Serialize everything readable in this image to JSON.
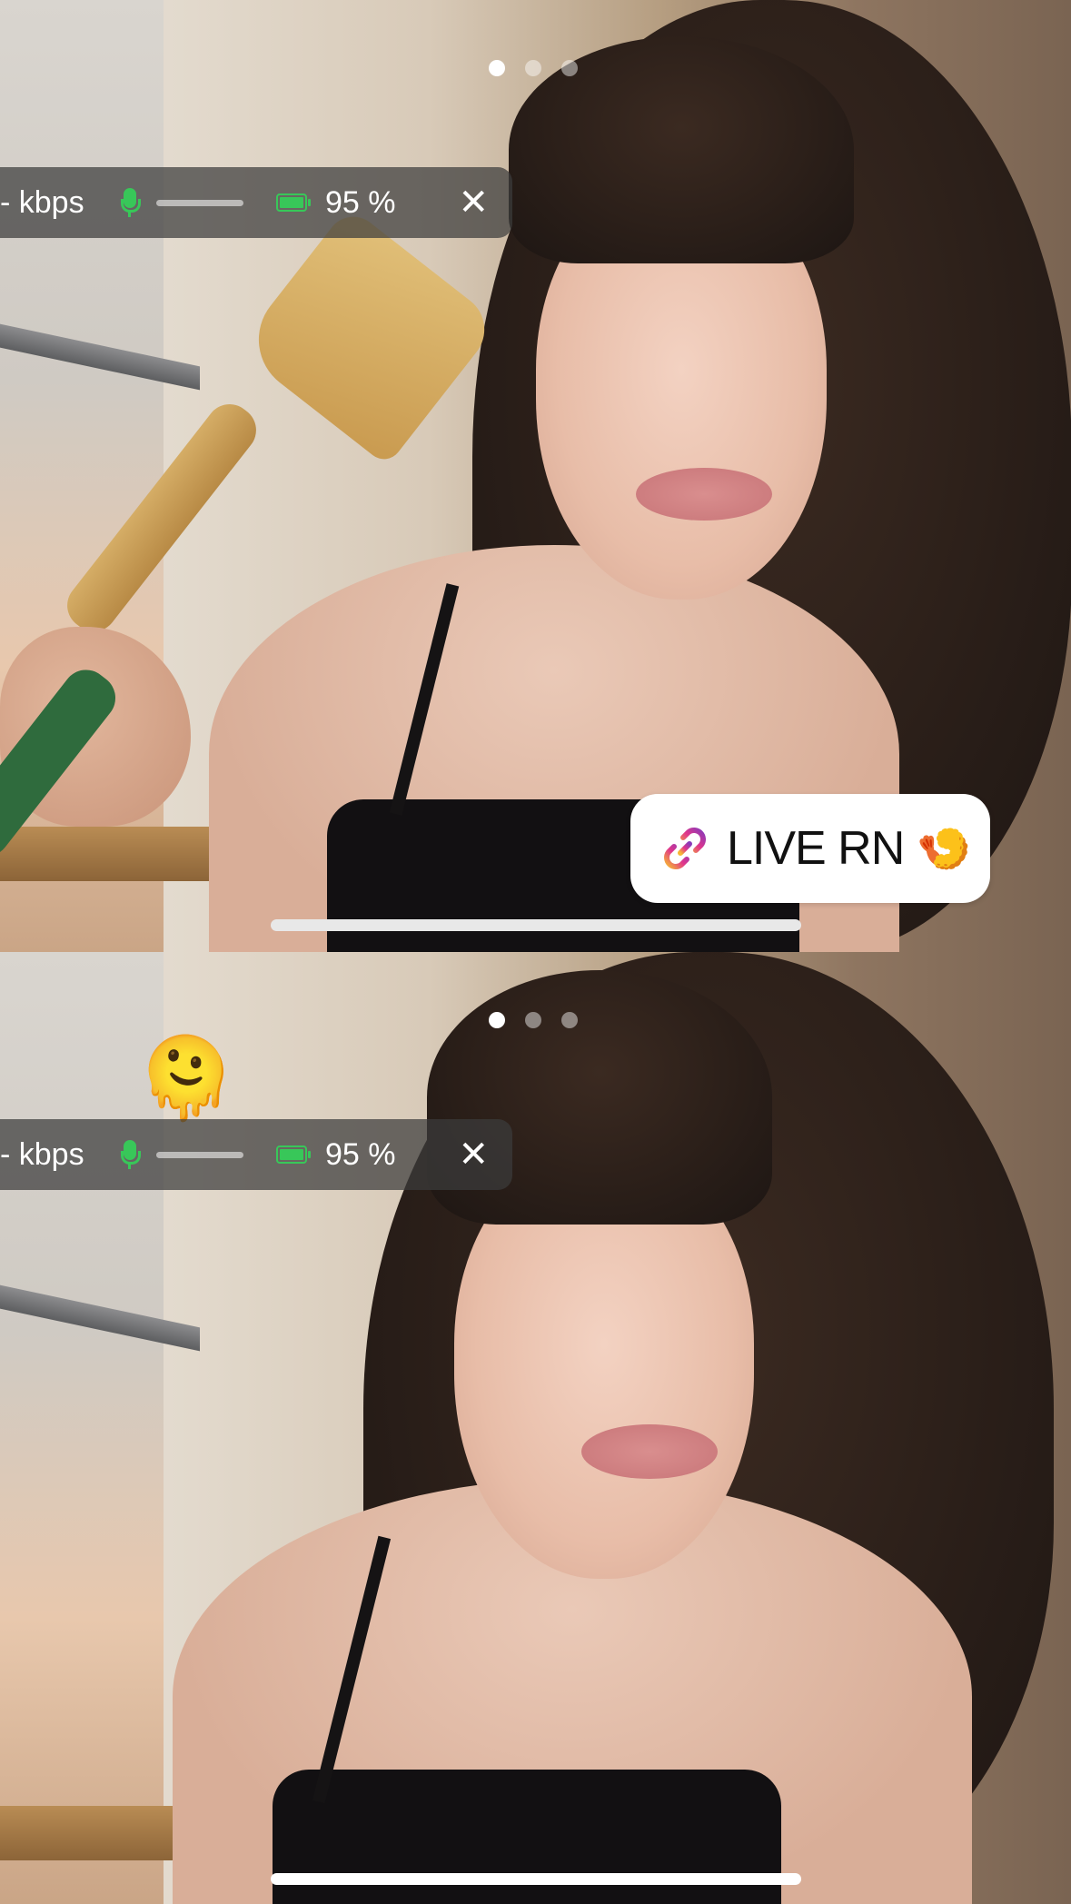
{
  "frames": [
    {
      "status": {
        "kbps_label": "- kbps",
        "battery_percent": "95 %",
        "mic_level": 0.0
      },
      "page_dots": {
        "count": 3,
        "active_index": 0
      },
      "sticker": {
        "text": "LIVE RN",
        "emoji": "🍤",
        "icon": "link-icon"
      }
    },
    {
      "status": {
        "kbps_label": "- kbps",
        "battery_percent": "95 %",
        "mic_level": 0.0
      },
      "page_dots": {
        "count": 3,
        "active_index": 0
      },
      "emoji_sticker": "🫠"
    }
  ],
  "colors": {
    "status_green": "#38c759",
    "pill_background": "rgba(60,60,60,0.72)",
    "sticker_background": "#ffffff"
  },
  "icons": [
    "microphone-icon",
    "battery-icon",
    "close-icon",
    "link-icon"
  ]
}
